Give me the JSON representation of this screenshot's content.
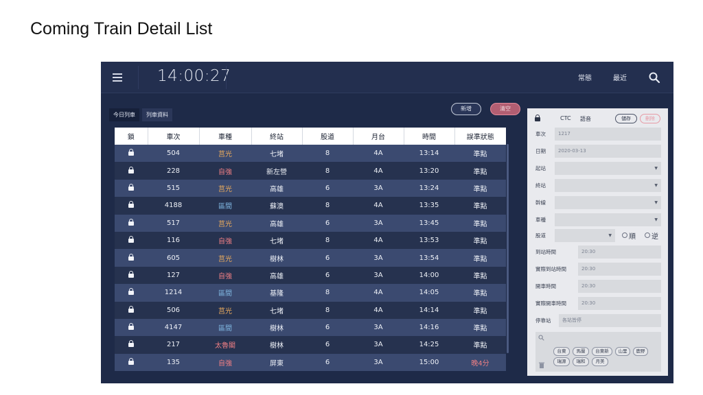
{
  "slide_title": "Coming Train Detail List",
  "header": {
    "clock": "14:00:27",
    "nav_normal": "常態",
    "nav_recent": "最近"
  },
  "tabs": [
    "今日列車",
    "列車資料"
  ],
  "actions": {
    "new": "新增",
    "clear": "清空"
  },
  "table": {
    "columns": [
      "鎖",
      "車次",
      "車種",
      "終站",
      "股道",
      "月台",
      "時間",
      "誤準狀態"
    ],
    "rows": [
      {
        "train": "504",
        "type": "莒光",
        "type_color": "orange",
        "dest": "七堵",
        "track": "8",
        "platform": "4A",
        "time": "13:14",
        "status": "準點",
        "late": false
      },
      {
        "train": "228",
        "type": "自強",
        "type_color": "red",
        "dest": "新左營",
        "track": "8",
        "platform": "4A",
        "time": "13:20",
        "status": "準點",
        "late": false
      },
      {
        "train": "515",
        "type": "莒光",
        "type_color": "orange",
        "dest": "高雄",
        "track": "6",
        "platform": "3A",
        "time": "13:24",
        "status": "準點",
        "late": false
      },
      {
        "train": "4188",
        "type": "區間",
        "type_color": "blue",
        "dest": "蘇澳",
        "track": "8",
        "platform": "4A",
        "time": "13:35",
        "status": "準點",
        "late": false
      },
      {
        "train": "517",
        "type": "莒光",
        "type_color": "orange",
        "dest": "高雄",
        "track": "6",
        "platform": "3A",
        "time": "13:45",
        "status": "準點",
        "late": false
      },
      {
        "train": "116",
        "type": "自強",
        "type_color": "red",
        "dest": "七堵",
        "track": "8",
        "platform": "4A",
        "time": "13:53",
        "status": "準點",
        "late": false
      },
      {
        "train": "605",
        "type": "莒光",
        "type_color": "orange",
        "dest": "樹林",
        "track": "6",
        "platform": "3A",
        "time": "13:54",
        "status": "準點",
        "late": false
      },
      {
        "train": "127",
        "type": "自強",
        "type_color": "red",
        "dest": "高雄",
        "track": "6",
        "platform": "3A",
        "time": "14:00",
        "status": "準點",
        "late": false
      },
      {
        "train": "1214",
        "type": "區間",
        "type_color": "blue",
        "dest": "基隆",
        "track": "8",
        "platform": "4A",
        "time": "14:05",
        "status": "準點",
        "late": false
      },
      {
        "train": "506",
        "type": "莒光",
        "type_color": "orange",
        "dest": "七堵",
        "track": "8",
        "platform": "4A",
        "time": "14:14",
        "status": "準點",
        "late": false
      },
      {
        "train": "4147",
        "type": "區間",
        "type_color": "blue",
        "dest": "樹林",
        "track": "6",
        "platform": "3A",
        "time": "14:16",
        "status": "準點",
        "late": false
      },
      {
        "train": "217",
        "type": "太魯閣",
        "type_color": "red",
        "dest": "樹林",
        "track": "6",
        "platform": "3A",
        "time": "14:25",
        "status": "準點",
        "late": false
      },
      {
        "train": "135",
        "type": "自強",
        "type_color": "red",
        "dest": "屏東",
        "track": "6",
        "platform": "3A",
        "time": "15:00",
        "status": "晚4分",
        "late": true
      }
    ]
  },
  "panel": {
    "ctc": "CTC",
    "voice": "語音",
    "save": "儲存",
    "delete": "刪除",
    "fields": [
      {
        "label": "車次",
        "value": "1217",
        "kind": "text"
      },
      {
        "label": "日期",
        "value": "2020-03-13",
        "kind": "text"
      },
      {
        "label": "起站",
        "value": "",
        "kind": "select"
      },
      {
        "label": "終站",
        "value": "",
        "kind": "select"
      },
      {
        "label": "幹線",
        "value": "",
        "kind": "select"
      },
      {
        "label": "車種",
        "value": "",
        "kind": "select"
      }
    ],
    "track_label": "股道",
    "dir_forward": "順",
    "dir_reverse": "逆",
    "times": [
      {
        "label": "到站時間",
        "value": "20:30"
      },
      {
        "label": "實際到站時間",
        "value": "20:30"
      },
      {
        "label": "開車時間",
        "value": "20:30"
      },
      {
        "label": "實際開車時間",
        "value": "20:30"
      }
    ],
    "stops_label": "停靠站",
    "stops_value": "各站皆停",
    "stations": [
      "台東",
      "馬蘭",
      "台東新",
      "山里",
      "鹿野",
      "瑞源",
      "瑞和",
      "月美"
    ]
  }
}
